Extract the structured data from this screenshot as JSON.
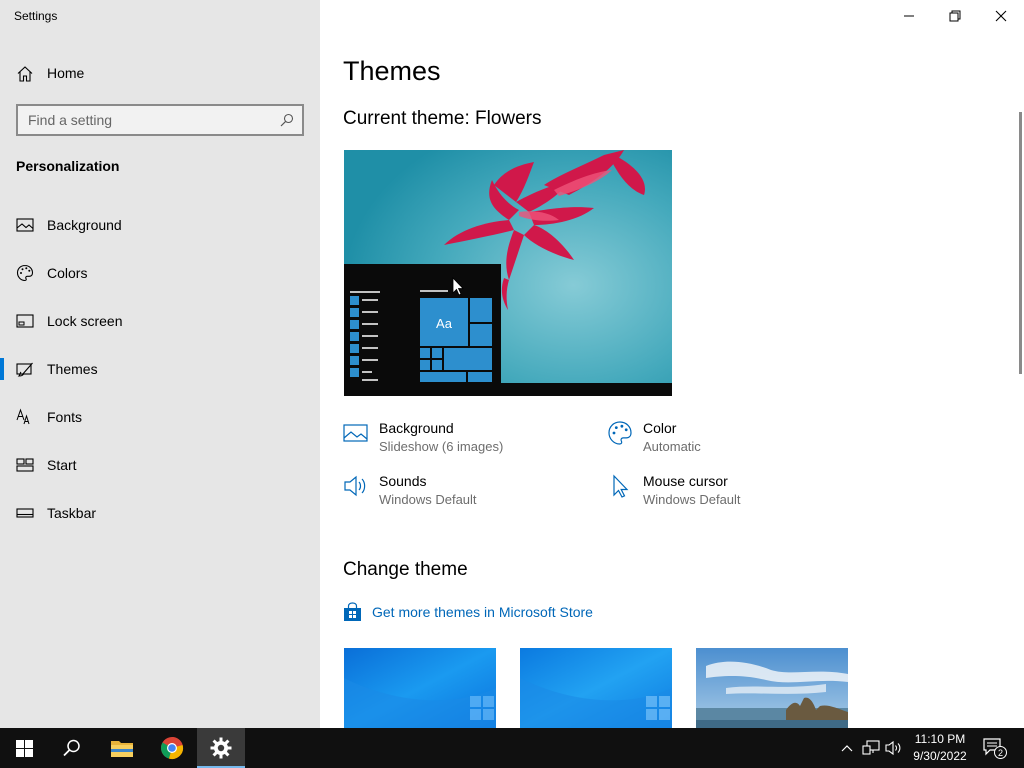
{
  "window": {
    "title": "Settings"
  },
  "sidebar": {
    "home_label": "Home",
    "search_placeholder": "Find a setting",
    "section_label": "Personalization",
    "items": [
      {
        "label": "Background",
        "icon": "picture-icon"
      },
      {
        "label": "Colors",
        "icon": "palette-icon"
      },
      {
        "label": "Lock screen",
        "icon": "lock-screen-icon"
      },
      {
        "label": "Themes",
        "icon": "brush-icon",
        "active": true
      },
      {
        "label": "Fonts",
        "icon": "font-icon"
      },
      {
        "label": "Start",
        "icon": "start-icon"
      },
      {
        "label": "Taskbar",
        "icon": "taskbar-icon"
      }
    ]
  },
  "main": {
    "title": "Themes",
    "current_theme": "Current theme: Flowers",
    "preview_tile_text": "Aa",
    "properties": [
      {
        "title": "Background",
        "value": "Slideshow (6 images)",
        "icon": "picture-icon"
      },
      {
        "title": "Color",
        "value": "Automatic",
        "icon": "palette-icon"
      },
      {
        "title": "Sounds",
        "value": "Windows Default",
        "icon": "speaker-icon"
      },
      {
        "title": "Mouse cursor",
        "value": "Windows Default",
        "icon": "cursor-icon"
      }
    ],
    "change_theme_title": "Change theme",
    "store_link": "Get more themes in Microsoft Store"
  },
  "taskbar": {
    "time": "11:10 PM",
    "date": "9/30/2022",
    "notification_count": "2"
  },
  "colors": {
    "accent": "#0078d7",
    "link": "#0067b8",
    "sidebar_bg": "#e6e6e6",
    "taskbar_bg": "#101010"
  }
}
